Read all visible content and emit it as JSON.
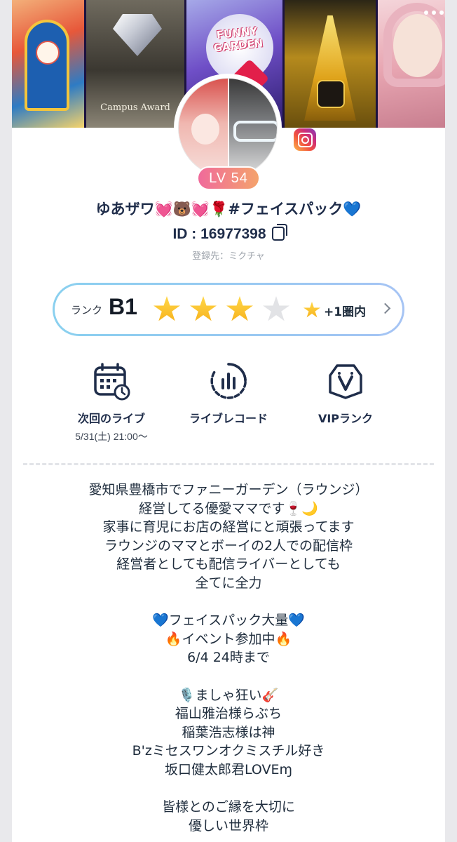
{
  "header": {
    "banner_award_text": "Campus Award",
    "banner_garden_text": "FUNNY GARDEN",
    "more_icon": "more-horizontal-icon"
  },
  "profile": {
    "level": "LV 54",
    "name": "ゆあザワ💓🐻💓🌹#フェイスパック💙",
    "id_text": "ID : 16977398",
    "platform": "登録先：ミクチャ",
    "social_icon": "instagram-icon"
  },
  "rank": {
    "label": "ランク",
    "value": "B1",
    "stars_filled": 3,
    "stars_total": 4,
    "next_text": "+1圏内"
  },
  "actions": [
    {
      "label": "次回のライブ",
      "sub": "5/31(土) 21:00〜",
      "icon": "calendar-icon"
    },
    {
      "label": "ライブレコード",
      "sub": "",
      "icon": "bar-chart-icon"
    },
    {
      "label": "VIPランク",
      "sub": "",
      "icon": "vip-badge-icon"
    }
  ],
  "bio": {
    "text": "愛知県豊橋市でファニーガーデン（ラウンジ）\n経営してる優愛ママです🍷🌙\n家事に育児にお店の経営にと頑張ってます\nラウンジのママとボーイの2人での配信枠\n経営者としても配信ライバーとしても\n全てに全力\n\n💙フェイスパック大量💙\n🔥イベント参加中🔥\n6/4  24時まで\n\n🎙️ましゃ狂い🎸\n福山雅治様らぶち\n稲葉浩志様は神\nB'zミセスワンオクミスチル好き\n坂口健太郎君LOVEɱ\n\n皆様とのご縁を大切に\n優しい世界枠"
  },
  "colors": {
    "text_dark": "#1f2d4a",
    "level_gradient_start": "#f06a9b",
    "level_gradient_end": "#f4a36c",
    "rank_border": "#8ad0ef",
    "star_on": "#f7b21c",
    "star_off": "#e2e3e6"
  }
}
